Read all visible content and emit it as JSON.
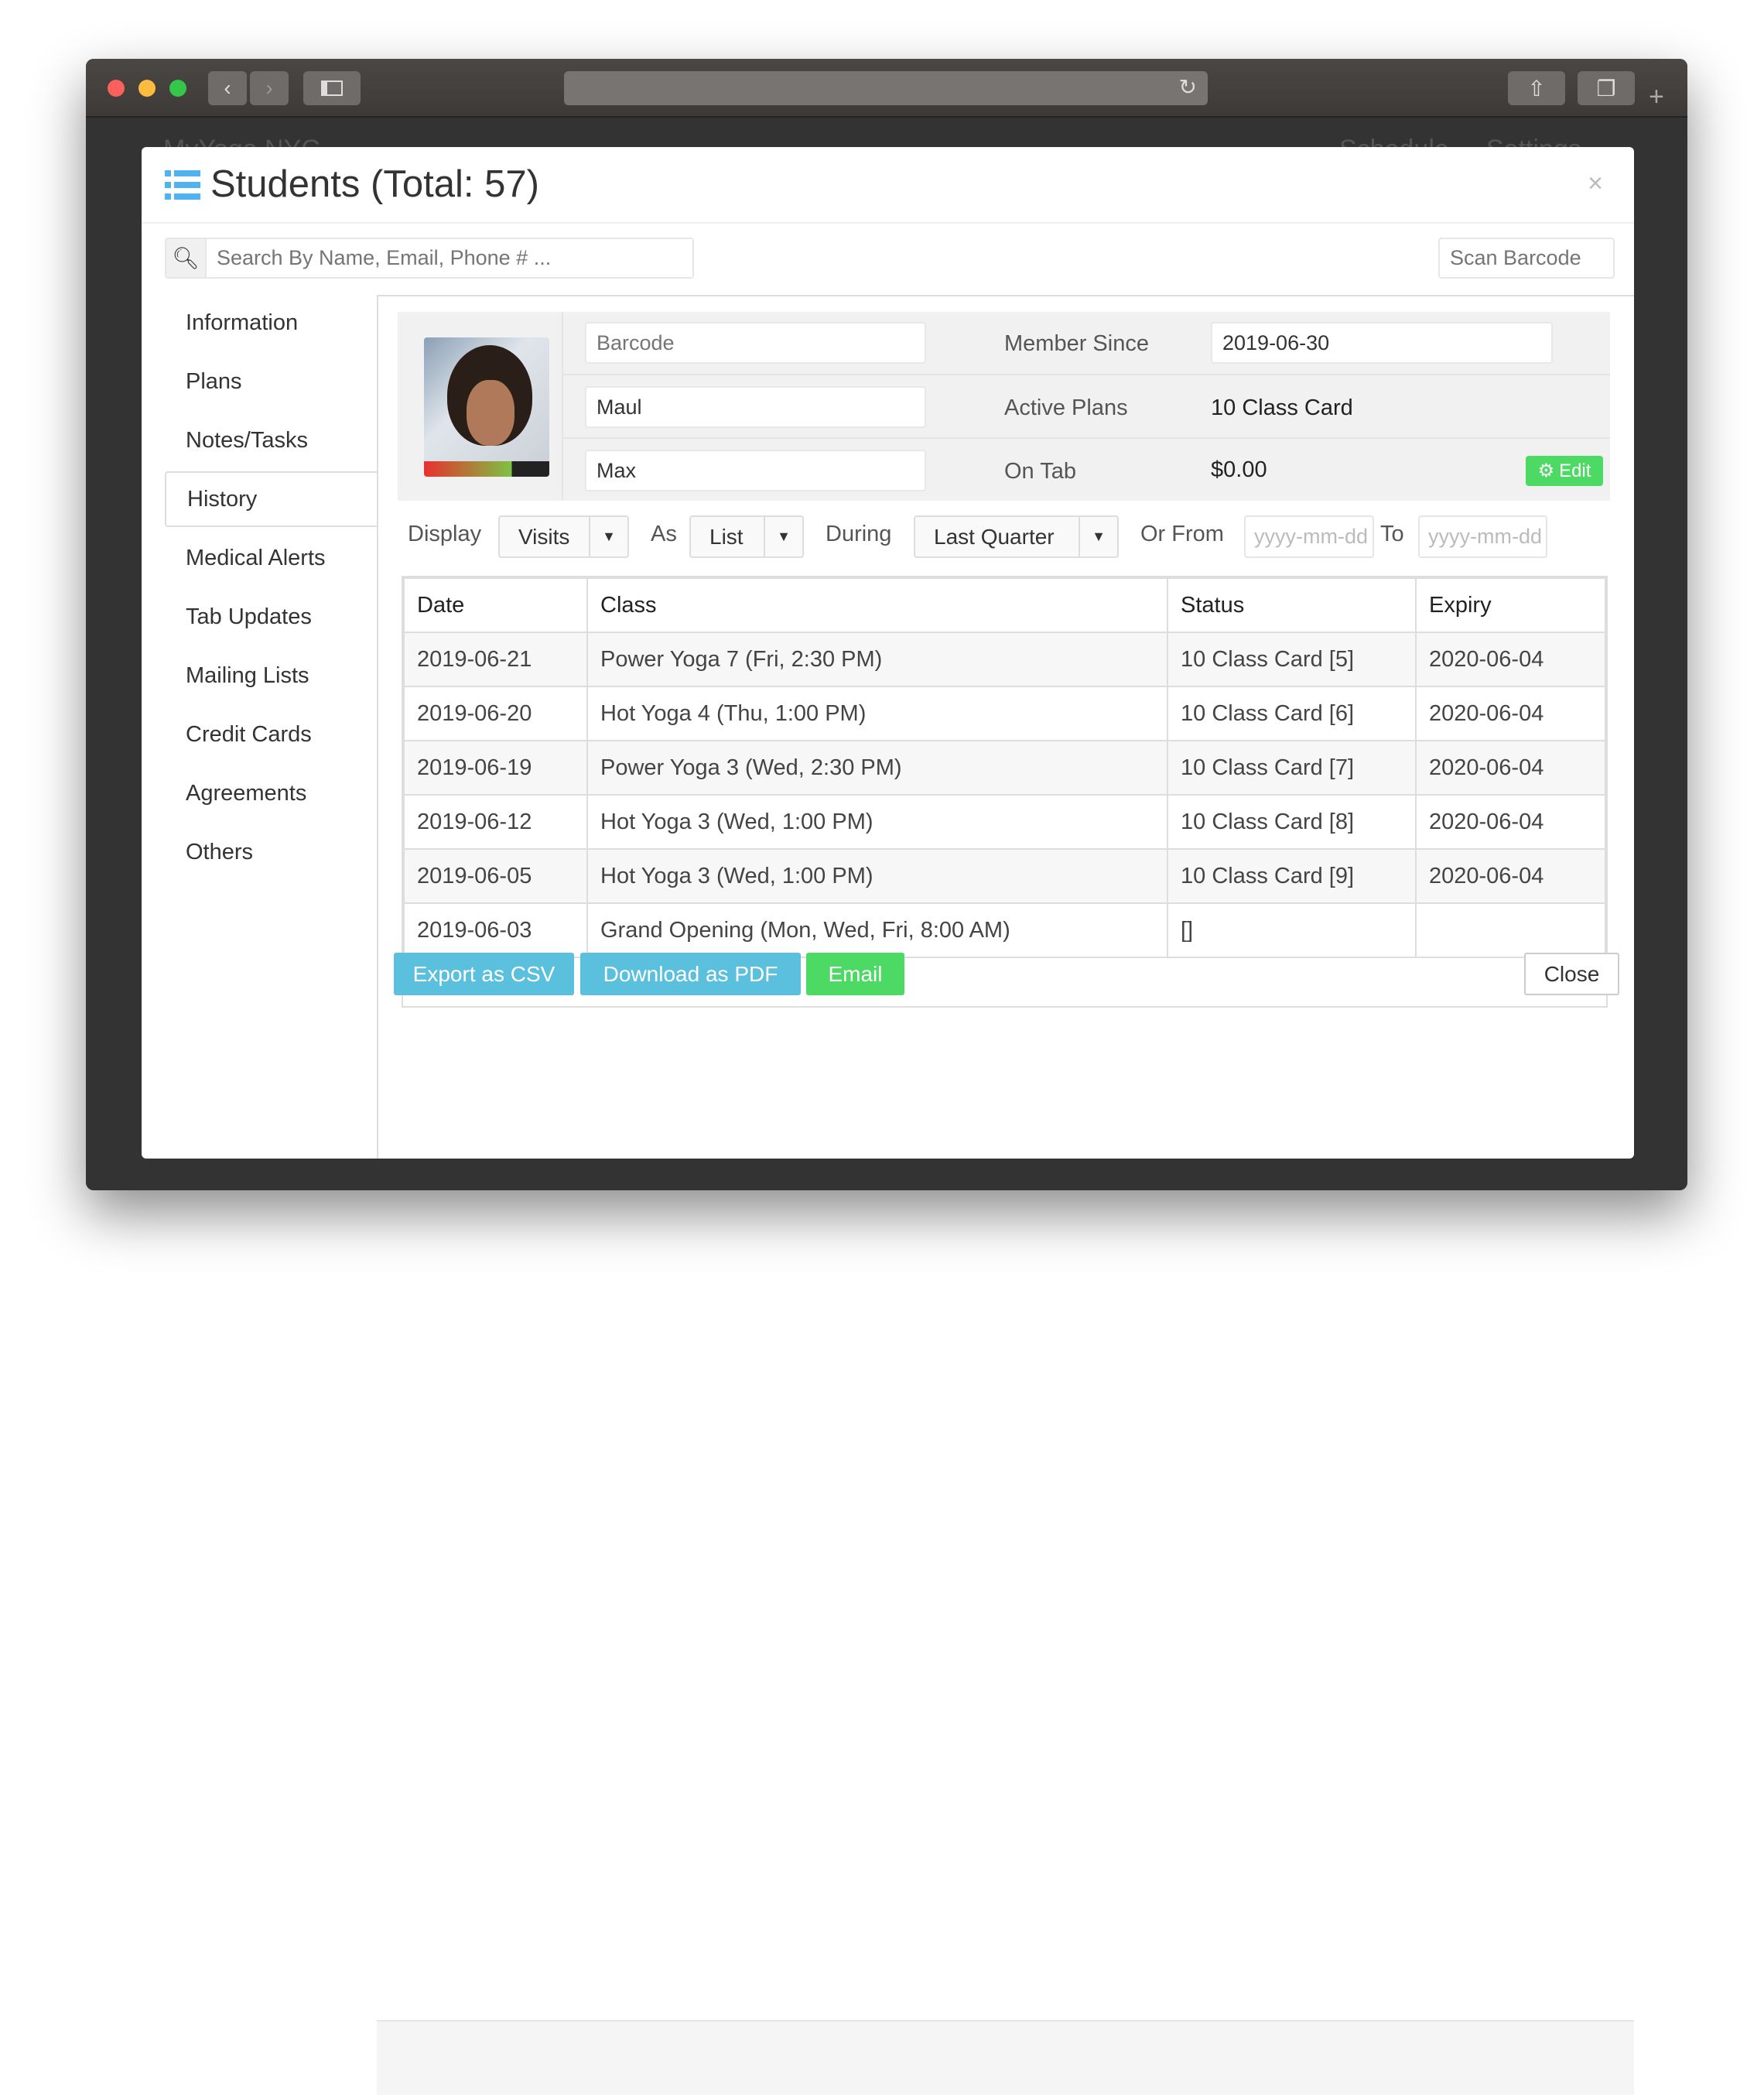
{
  "browser": {
    "back_icon": "‹",
    "forward_icon": "›",
    "colors": {
      "close": "#fc605c",
      "minimize": "#fdbc40",
      "maximize": "#34c84a"
    }
  },
  "background_app": {
    "brand": "MyYoga NYC",
    "nav": [
      "Schedule",
      "Settings"
    ]
  },
  "modal": {
    "title": "Students (Total: 57)",
    "close_icon": "×",
    "search": {
      "placeholder": "Search By Name, Email, Phone # ..."
    },
    "scan": {
      "placeholder": "Scan Barcode"
    },
    "nav": [
      {
        "label": "Information"
      },
      {
        "label": "Plans"
      },
      {
        "label": "Notes/Tasks"
      },
      {
        "label": "History",
        "active": true
      },
      {
        "label": "Medical Alerts"
      },
      {
        "label": "Tab Updates"
      },
      {
        "label": "Mailing Lists"
      },
      {
        "label": "Credit Cards"
      },
      {
        "label": "Agreements"
      },
      {
        "label": "Others"
      }
    ],
    "profile": {
      "barcode_placeholder": "Barcode",
      "last_name": "Maul",
      "first_name": "Max",
      "member_since_label": "Member Since",
      "member_since": "2019-06-30",
      "active_plans_label": "Active Plans",
      "active_plans": "10 Class Card",
      "on_tab_label": "On Tab",
      "on_tab": "$0.00",
      "edit_label": "Edit"
    },
    "filters": {
      "display_label": "Display",
      "display_value": "Visits",
      "as_label": "As",
      "as_value": "List",
      "during_label": "During",
      "during_value": "Last Quarter",
      "from_label": "Or From",
      "from_placeholder": "yyyy-mm-dd",
      "to_label": "To",
      "to_placeholder": "yyyy-mm-dd"
    },
    "table": {
      "headers": [
        "Date",
        "Class",
        "Status",
        "Expiry"
      ],
      "rows": [
        [
          "2019-06-21",
          "Power Yoga 7 (Fri, 2:30 PM)",
          "10 Class Card [5]",
          "2020-06-04"
        ],
        [
          "2019-06-20",
          "Hot Yoga 4 (Thu, 1:00 PM)",
          "10 Class Card [6]",
          "2020-06-04"
        ],
        [
          "2019-06-19",
          "Power Yoga 3 (Wed, 2:30 PM)",
          "10 Class Card [7]",
          "2020-06-04"
        ],
        [
          "2019-06-12",
          "Hot Yoga 3 (Wed, 1:00 PM)",
          "10 Class Card [8]",
          "2020-06-04"
        ],
        [
          "2019-06-05",
          "Hot Yoga 3 (Wed, 1:00 PM)",
          "10 Class Card [9]",
          "2020-06-04"
        ],
        [
          "2019-06-03",
          "Grand Opening (Mon, Wed, Fri, 8:00 AM)",
          "[]",
          ""
        ]
      ]
    },
    "footer": {
      "export_csv": "Export as CSV",
      "download_pdf": "Download as PDF",
      "email": "Email",
      "close": "Close"
    },
    "colors": {
      "accent_blue": "#5bc0de",
      "green": "#4cd964",
      "title_icon": "#4fb3f0"
    }
  }
}
